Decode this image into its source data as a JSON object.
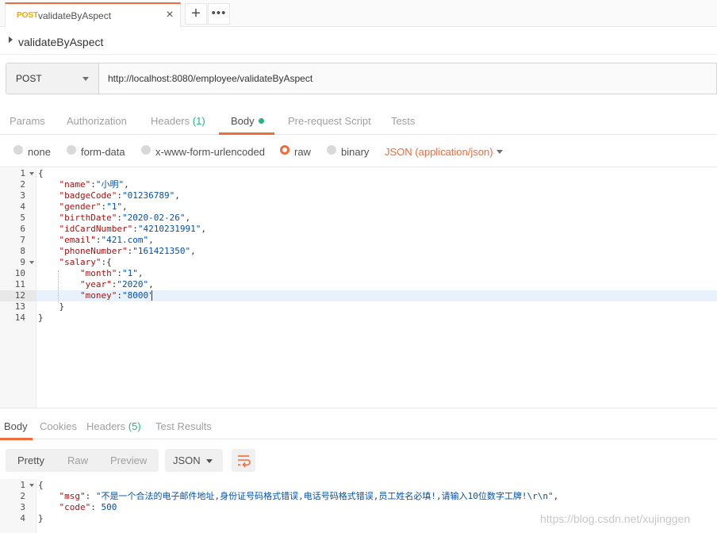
{
  "tab": {
    "method": "POST",
    "name": "validateByAspect",
    "close_icon": "×",
    "add_icon": "+",
    "more_icon": "•••"
  },
  "request": {
    "name": "validateByAspect",
    "method": "POST",
    "url": "http://localhost:8080/employee/validateByAspect"
  },
  "request_tabs": [
    {
      "label": "Params"
    },
    {
      "label": "Authorization"
    },
    {
      "label": "Headers",
      "count": "(1)"
    },
    {
      "label": "Body",
      "active": true
    },
    {
      "label": "Pre-request Script"
    },
    {
      "label": "Tests"
    }
  ],
  "body_options": {
    "none": "none",
    "form_data": "form-data",
    "urlencoded": "x-www-form-urlencoded",
    "raw": "raw",
    "binary": "binary",
    "content_type": "JSON (application/json)",
    "selected": "raw"
  },
  "request_body": {
    "lines": [
      {
        "n": "1",
        "text": "{"
      },
      {
        "n": "2",
        "text": "    \"name\":\"小明\","
      },
      {
        "n": "3",
        "text": "    \"badgeCode\":\"01236789\","
      },
      {
        "n": "4",
        "text": "    \"gender\":\"1\","
      },
      {
        "n": "5",
        "text": "    \"birthDate\":\"2020-02-26\","
      },
      {
        "n": "6",
        "text": "    \"idCardNumber\":\"4210231991\","
      },
      {
        "n": "7",
        "text": "    \"email\":\"421.com\","
      },
      {
        "n": "8",
        "text": "    \"phoneNumber\":\"161421350\","
      },
      {
        "n": "9",
        "text": "    \"salary\":{"
      },
      {
        "n": "10",
        "text": "        \"month\":\"1\","
      },
      {
        "n": "11",
        "text": "        \"year\":\"2020\","
      },
      {
        "n": "12",
        "text": "        \"money\":\"8000\""
      },
      {
        "n": "13",
        "text": "    }"
      },
      {
        "n": "14",
        "text": "}"
      }
    ],
    "highlighted_line": "12"
  },
  "response_tabs": [
    {
      "label": "Body",
      "active": true
    },
    {
      "label": "Cookies"
    },
    {
      "label": "Headers",
      "count": "(5)"
    },
    {
      "label": "Test Results"
    }
  ],
  "response_toolbar": {
    "views": [
      "Pretty",
      "Raw",
      "Preview"
    ],
    "active_view": "Pretty",
    "format": "JSON",
    "wrap_icon": "wrap-lines-icon"
  },
  "response_body": {
    "lines": [
      {
        "n": "1",
        "text": "{"
      },
      {
        "n": "2",
        "text": "    \"msg\": \"不是一个合法的电子邮件地址,身份证号码格式错误,电话号码格式错误,员工姓名必填!,请输入10位数字工牌!\\r\\n\","
      },
      {
        "n": "3",
        "text": "    \"code\": 500"
      },
      {
        "n": "4",
        "text": "}"
      }
    ]
  },
  "watermark": "https://blog.csdn.net/xujinggen",
  "colors": {
    "accent": "#f26b3a",
    "green": "#26b47f",
    "method_post": "#e8a80c",
    "key": "#a31515",
    "string": "#0451a5"
  }
}
